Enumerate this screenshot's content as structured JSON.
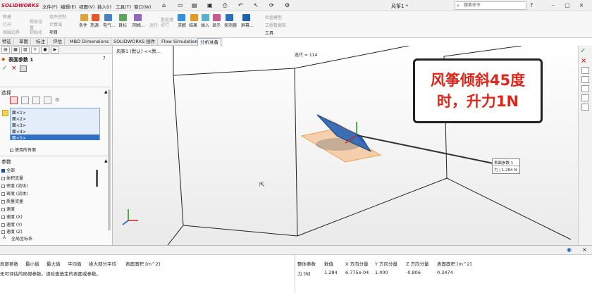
{
  "app": {
    "logo": "SOLIDWORKS",
    "doc_title": "风筝1 *",
    "menus": [
      "文件(F)",
      "编辑(E)",
      "视图(V)",
      "插入(I)",
      "工具(T)",
      "窗口(W)"
    ]
  },
  "search": {
    "placeholder": "搜索命令"
  },
  "ribbon": {
    "left_small": [
      "新建",
      "打开",
      "周围边界"
    ],
    "col2_small": [
      "帮助设置",
      "初始化"
    ],
    "col3_small": [
      "组件控制",
      "计算域",
      "项目"
    ],
    "groups": [
      "条件",
      "热源",
      "电气...",
      "目标",
      "网格...",
      "运行",
      "批处理运行",
      "求解",
      "结果",
      "插入",
      "显示",
      "探测器",
      "屏幕..."
    ],
    "right_small": [
      "检查模型",
      "工程数据库",
      "工具"
    ]
  },
  "tabs": [
    "特征",
    "草图",
    "标注",
    "评估",
    "MBD Dimensions",
    "SOLIDWORKS 插件",
    "Flow Simulation",
    "分析准备"
  ],
  "panel": {
    "title": "表面参数 1",
    "selection_label": "选择",
    "faces": [
      "面<1>",
      "面<2>",
      "面<3>",
      "面<4>",
      "面<5>"
    ],
    "use_all_faces": "使用所有面",
    "params_label": "参数",
    "params": [
      "全部",
      "体积流量",
      "密度 (流体)",
      "密度 (流体)",
      "质量流量",
      "速度",
      "速度 (X)",
      "速度 (Y)",
      "速度 (Z)"
    ],
    "coord": "全局坐标系"
  },
  "viewport": {
    "tree_label": "风筝1 (默认) <<默...",
    "iteration": "迭代 = 114",
    "callout_line1": "风筝倾斜45度",
    "callout_line2": "时，升力1N",
    "tooltip_title": "表面参数 1",
    "tooltip_value": "力 | 1.284 N"
  },
  "bottom_left": {
    "headers": [
      "局部参数",
      "最小值",
      "最大值",
      "平均值",
      "绝大部分平均",
      "表面面积 [m^2]"
    ],
    "message": "无可评估的局部参数。请检查选定的表面或参数。"
  },
  "bottom_right": {
    "headers": [
      "整体参数",
      "数值",
      "X 方向分量",
      "Y 方向分量",
      "Z 方向分量",
      "表面面积 [m^2]"
    ],
    "row": [
      "力 [N]",
      "1.284",
      "6.775e-04",
      "1.000",
      "-0.806",
      "0.3474"
    ]
  },
  "colors": {
    "brand": "#c8102e",
    "callout_text": "#e0261a",
    "selection": "#3270c8",
    "face_highlight": "#f08a24"
  }
}
